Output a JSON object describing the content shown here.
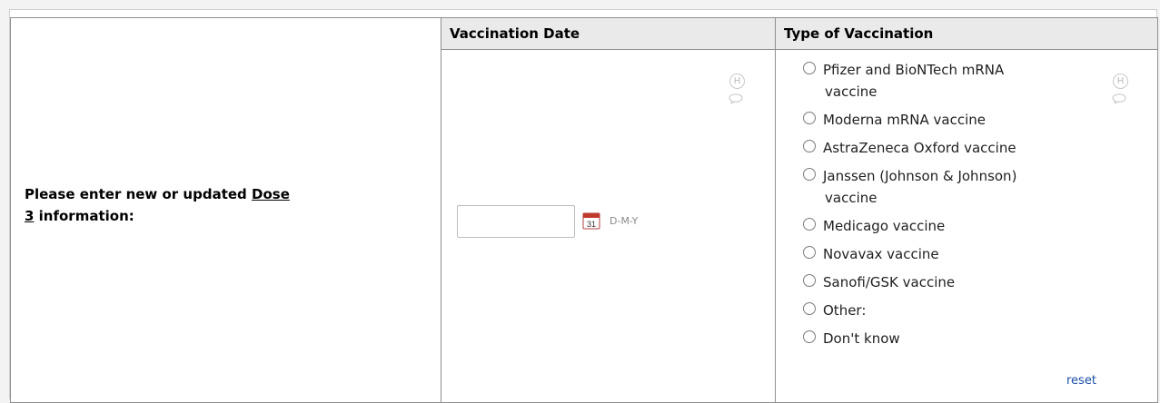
{
  "headers": {
    "vaccination_date": "Vaccination Date",
    "type_of_vaccination": "Type of Vaccination"
  },
  "prompt": {
    "before": "Please enter new or updated ",
    "dose_link": "Dose",
    "number": "3",
    "after": " information:"
  },
  "date_field": {
    "value": "",
    "format_label": "D-M-Y"
  },
  "history_icon_text": "H",
  "options": [
    {
      "label_line1": "Pfizer and BioNTech mRNA",
      "label_line2": "vaccine"
    },
    {
      "label_line1": "Moderna mRNA vaccine"
    },
    {
      "label_line1": "AstraZeneca Oxford vaccine"
    },
    {
      "label_line1": "Janssen (Johnson & Johnson)",
      "label_line2": "vaccine"
    },
    {
      "label_line1": "Medicago vaccine"
    },
    {
      "label_line1": "Novavax vaccine"
    },
    {
      "label_line1": "Sanofi/GSK vaccine"
    },
    {
      "label_line1": "Other:"
    },
    {
      "label_line1": "Don't know"
    }
  ],
  "reset_label": "reset",
  "icons": [
    "history-icon",
    "comment-icon",
    "calendar-icon",
    "radio-icon"
  ]
}
